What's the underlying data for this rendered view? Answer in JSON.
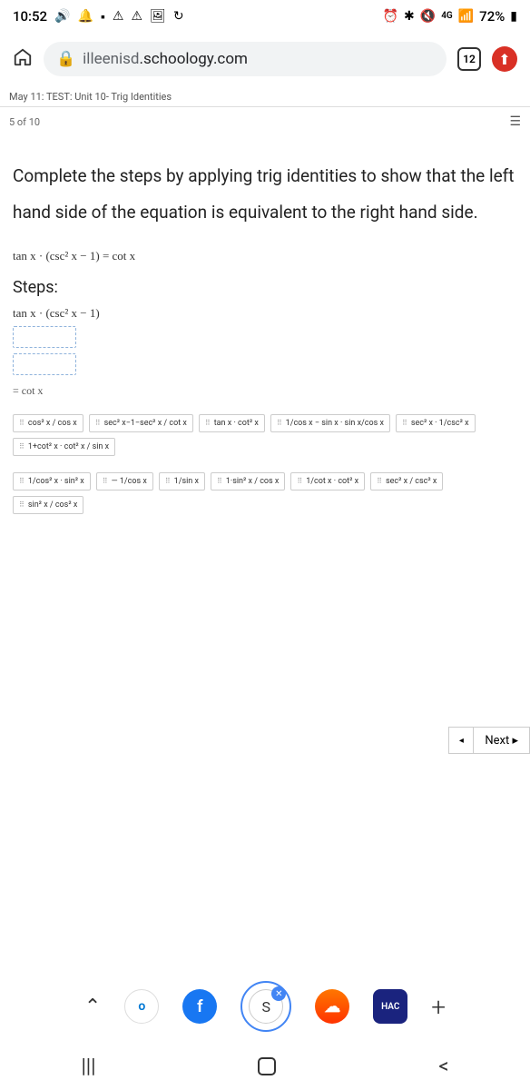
{
  "status": {
    "time": "10:52",
    "battery": "72%",
    "network_label": "4G"
  },
  "browser": {
    "url_prefix": "illeenisd",
    "url_domain": ".schoology.com",
    "tab_count": "12"
  },
  "breadcrumb": "May 11: TEST: Unit 10- Trig Identities",
  "progress": "5 of 10",
  "question": {
    "prompt": "Complete the steps by applying trig identities to show that the left hand side of the equation is equivalent to the right hand side.",
    "given": "tan x · (csc² x − 1) = cot x",
    "steps_label": "Steps:",
    "step_start": "tan x · (csc² x − 1)",
    "final": "= cot x"
  },
  "tiles_row1": [
    "cos² x / cos x",
    "sec² x−1−sec² x / cot x",
    "tan x · cot² x",
    "1/cos x − sin x · sin x/cos x",
    "sec² x · 1/csc² x",
    "1+cot² x · cot² x / sin x"
  ],
  "tiles_row2": [
    "1/cos² x · sin² x",
    "— 1/cos x",
    "1/sin x",
    "1·sin² x / cos x",
    "1/cot x · cot² x",
    "sec² x / csc² x",
    "sin² x / cos² x"
  ],
  "nav": {
    "next": "Next ▸",
    "prev": "◂"
  },
  "dock": {
    "hac": "HAC"
  }
}
